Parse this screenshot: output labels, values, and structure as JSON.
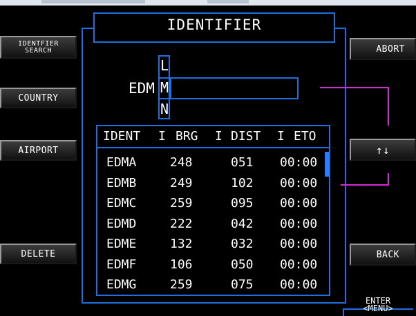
{
  "title": "IDENTIFIER",
  "left_buttons": {
    "identifier_search": "IDENTFIER SEARCH",
    "country": "COUNTRY",
    "airport": "AIRPORT",
    "delete": "DELETE"
  },
  "right_buttons": {
    "abort": "ABORT",
    "up_down": "↑↓",
    "back": "BACK",
    "enter": "ENTER",
    "menu": "<MENU>"
  },
  "entry": {
    "text": "EDM",
    "char_prev": "L",
    "char_current": "M",
    "char_next": "N"
  },
  "table": {
    "headers": [
      "IDENT",
      "BRG",
      "DIST",
      "ETO"
    ],
    "separator": "I",
    "rows": [
      {
        "ident": "EDMA",
        "brg": "248",
        "dist": "051",
        "eto": "00:00"
      },
      {
        "ident": "EDMB",
        "brg": "249",
        "dist": "102",
        "eto": "00:00"
      },
      {
        "ident": "EDMC",
        "brg": "259",
        "dist": "095",
        "eto": "00:00"
      },
      {
        "ident": "EDMD",
        "brg": "222",
        "dist": "042",
        "eto": "00:00"
      },
      {
        "ident": "EDME",
        "brg": "132",
        "dist": "032",
        "eto": "00:00"
      },
      {
        "ident": "EDMF",
        "brg": "106",
        "dist": "050",
        "eto": "00:00"
      },
      {
        "ident": "EDMG",
        "brg": "259",
        "dist": "075",
        "eto": "00:00"
      }
    ]
  },
  "colors": {
    "frame": "#1f6fe0",
    "annotation": "#d42cd4",
    "background": "#000000",
    "text": "#ffffff"
  }
}
